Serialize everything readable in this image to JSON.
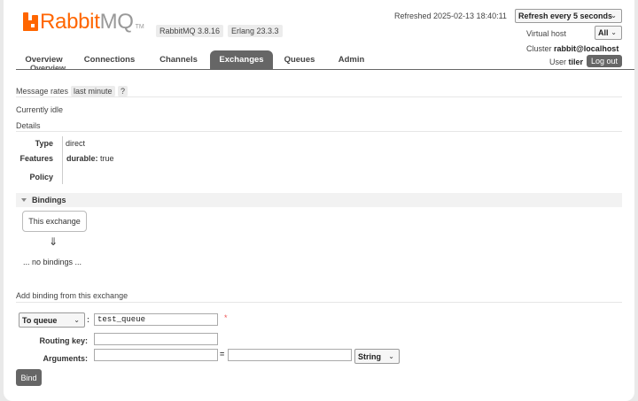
{
  "header": {
    "logo_rabbit": "Rabbit",
    "logo_mq": "MQ",
    "logo_tm": "TM",
    "rabbitmq_version": "RabbitMQ 3.8.16",
    "erlang_version": "Erlang 23.3.3",
    "refreshed": "Refreshed 2025-02-13 18:40:11",
    "refresh_select": "Refresh every 5 seconds",
    "vhost_label": "Virtual host",
    "vhost_select": "All",
    "cluster_label": "Cluster",
    "cluster_name": "rabbit@localhost",
    "user_label": "User",
    "user_name": "tiler",
    "logout": "Log out"
  },
  "tabs": [
    "Overview",
    "Connections",
    "Channels",
    "Exchanges",
    "Queues",
    "Admin"
  ],
  "active_tab": "Exchanges",
  "overview_peek": "Overview",
  "message_rates": {
    "label": "Message rates",
    "period": "last minute",
    "help": "?"
  },
  "status": "Currently idle",
  "details": {
    "title": "Details",
    "type_key": "Type",
    "type_val": "direct",
    "features_key": "Features",
    "features_val_key": "durable:",
    "features_val": "true",
    "policy_key": "Policy"
  },
  "bindings": {
    "title": "Bindings",
    "this_exchange": "This exchange",
    "arrow": "⇓",
    "none": "... no bindings ..."
  },
  "add_binding": {
    "title": "Add binding from this exchange",
    "destination_type": "To queue",
    "colon": ":",
    "destination_value": "test_queue",
    "required": "*",
    "routing_key_label": "Routing key:",
    "arguments_label": "Arguments:",
    "equals": "=",
    "arg_type": "String",
    "bind_button": "Bind"
  }
}
